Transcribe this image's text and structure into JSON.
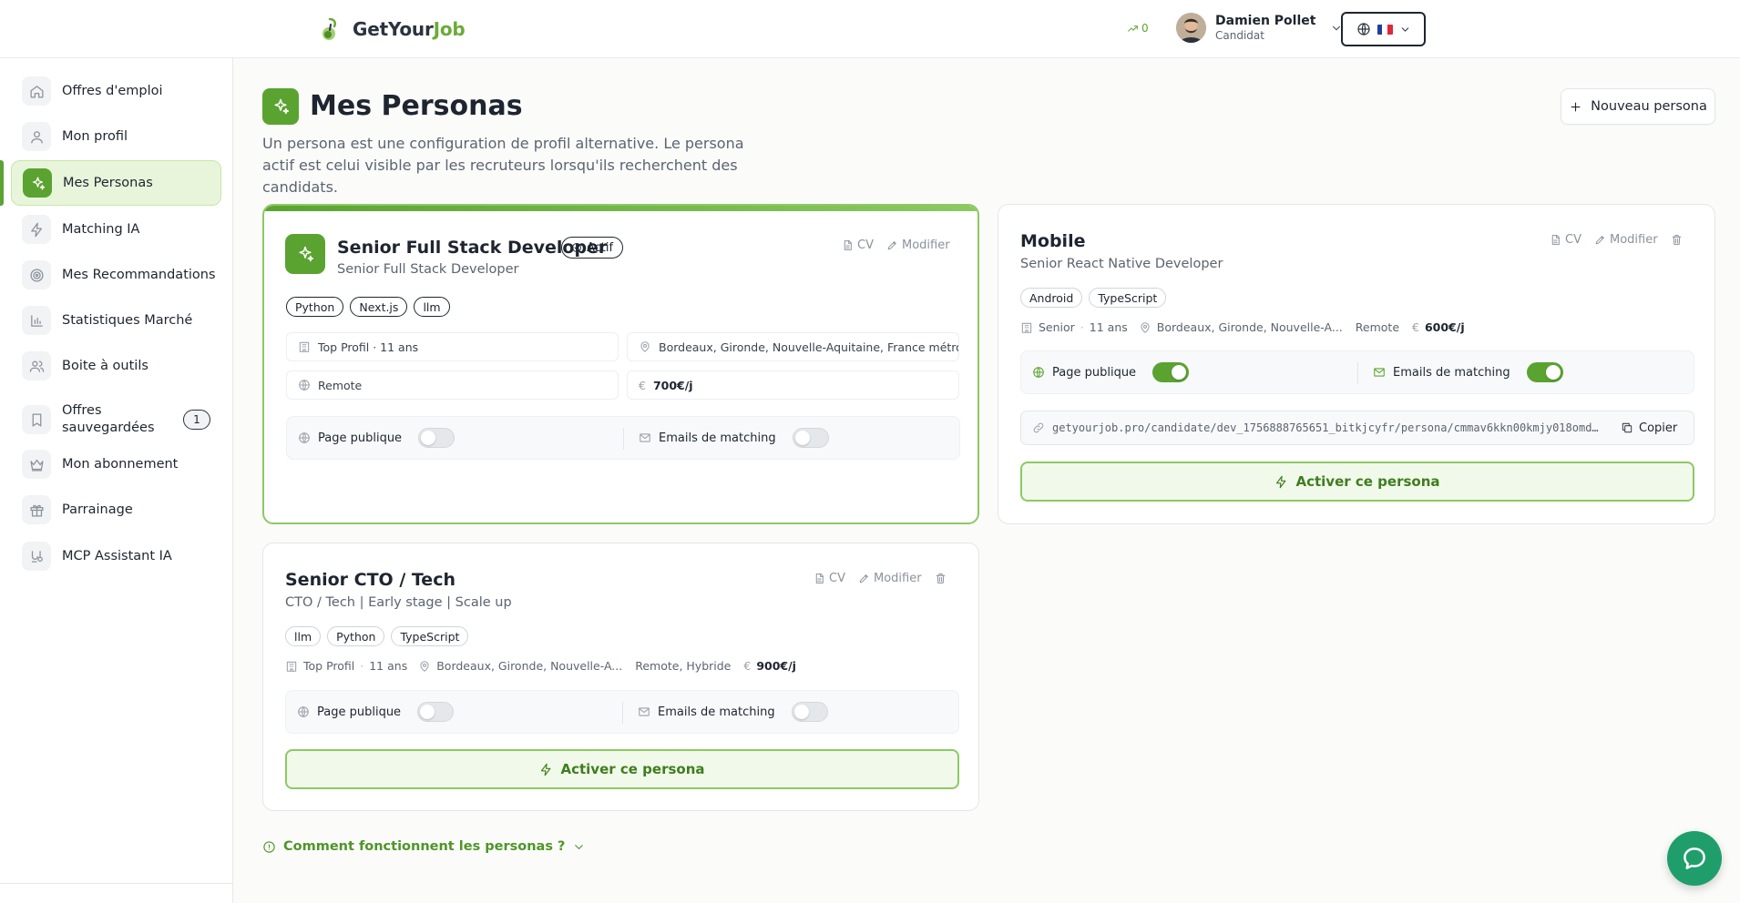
{
  "header": {
    "brand_part1": "GetYour",
    "brand_part2": "Job",
    "trend_value": "0",
    "user_name": "Damien Pollet",
    "user_role": "Candidat",
    "language_flag": "fr"
  },
  "sidebar": {
    "items": [
      {
        "label": "Offres d'emploi",
        "icon": "home-icon"
      },
      {
        "label": "Mon profil",
        "icon": "user-icon"
      },
      {
        "label": "Mes Personas",
        "icon": "sparkles-icon",
        "active": true
      },
      {
        "label": "Matching IA",
        "icon": "zap-icon"
      },
      {
        "label": "Mes Recommandations",
        "icon": "target-icon"
      },
      {
        "label": "Statistiques Marché",
        "icon": "bar-chart-icon"
      },
      {
        "label": "Boite à outils",
        "icon": "users-icon"
      },
      {
        "label": "Offres sauvegardées",
        "icon": "bookmark-icon",
        "badge": "1"
      },
      {
        "label": "Mon abonnement",
        "icon": "crown-icon"
      },
      {
        "label": "Parrainage",
        "icon": "gift-icon"
      },
      {
        "label": "MCP Assistant IA",
        "icon": "robot-icon"
      }
    ]
  },
  "page": {
    "title": "Mes Personas",
    "description": "Un persona est une configuration de profil alternative. Le persona actif est celui visible par les recruteurs lorsqu'ils recherchent des candidats.",
    "new_button": "Nouveau persona",
    "faq_label": "Comment fonctionnent les personas ?"
  },
  "labels": {
    "cv": "CV",
    "edit": "Modifier",
    "active_badge": "Actif",
    "public_page": "Page publique",
    "matching_emails": "Emails de matching",
    "activate": "Activer ce persona",
    "copy": "Copier"
  },
  "personas": [
    {
      "title": "Senior Full Stack Developer",
      "subtitle": "Senior Full Stack Developer",
      "active": true,
      "tags": [
        "Python",
        "Next.js",
        "llm"
      ],
      "level": "Top Profil · 11 ans",
      "location": "Bordeaux, Gironde, Nouvelle-Aquitaine, France métro...",
      "work_mode": "Remote",
      "rate": "700€/j",
      "public_page": false,
      "matching_emails": false
    },
    {
      "title": "Mobile",
      "subtitle": "Senior React Native Developer",
      "active": false,
      "tags": [
        "Android",
        "TypeScript"
      ],
      "level": "Senior",
      "experience": "11 ans",
      "location": "Bordeaux, Gironde, Nouvelle-A...",
      "work_mode": "Remote",
      "rate": "600€/j",
      "public_page": true,
      "matching_emails": true,
      "url": "getyourjob.pro/candidate/dev_1756888765651_bitkjcyfr/persona/cmmav6kkn00kmjy018omd..."
    },
    {
      "title": "Senior CTO / Tech",
      "subtitle": "CTO / Tech | Early stage | Scale up",
      "active": false,
      "tags": [
        "llm",
        "Python",
        "TypeScript"
      ],
      "level": "Top Profil",
      "experience": "11 ans",
      "location": "Bordeaux, Gironde, Nouvelle-A...",
      "work_mode": "Remote, Hybride",
      "rate": "900€/j",
      "public_page": false,
      "matching_emails": false
    }
  ],
  "colors": {
    "accent": "#5aa331",
    "accent_light": "#e8f5da",
    "chat_button": "#1f9e6b"
  }
}
